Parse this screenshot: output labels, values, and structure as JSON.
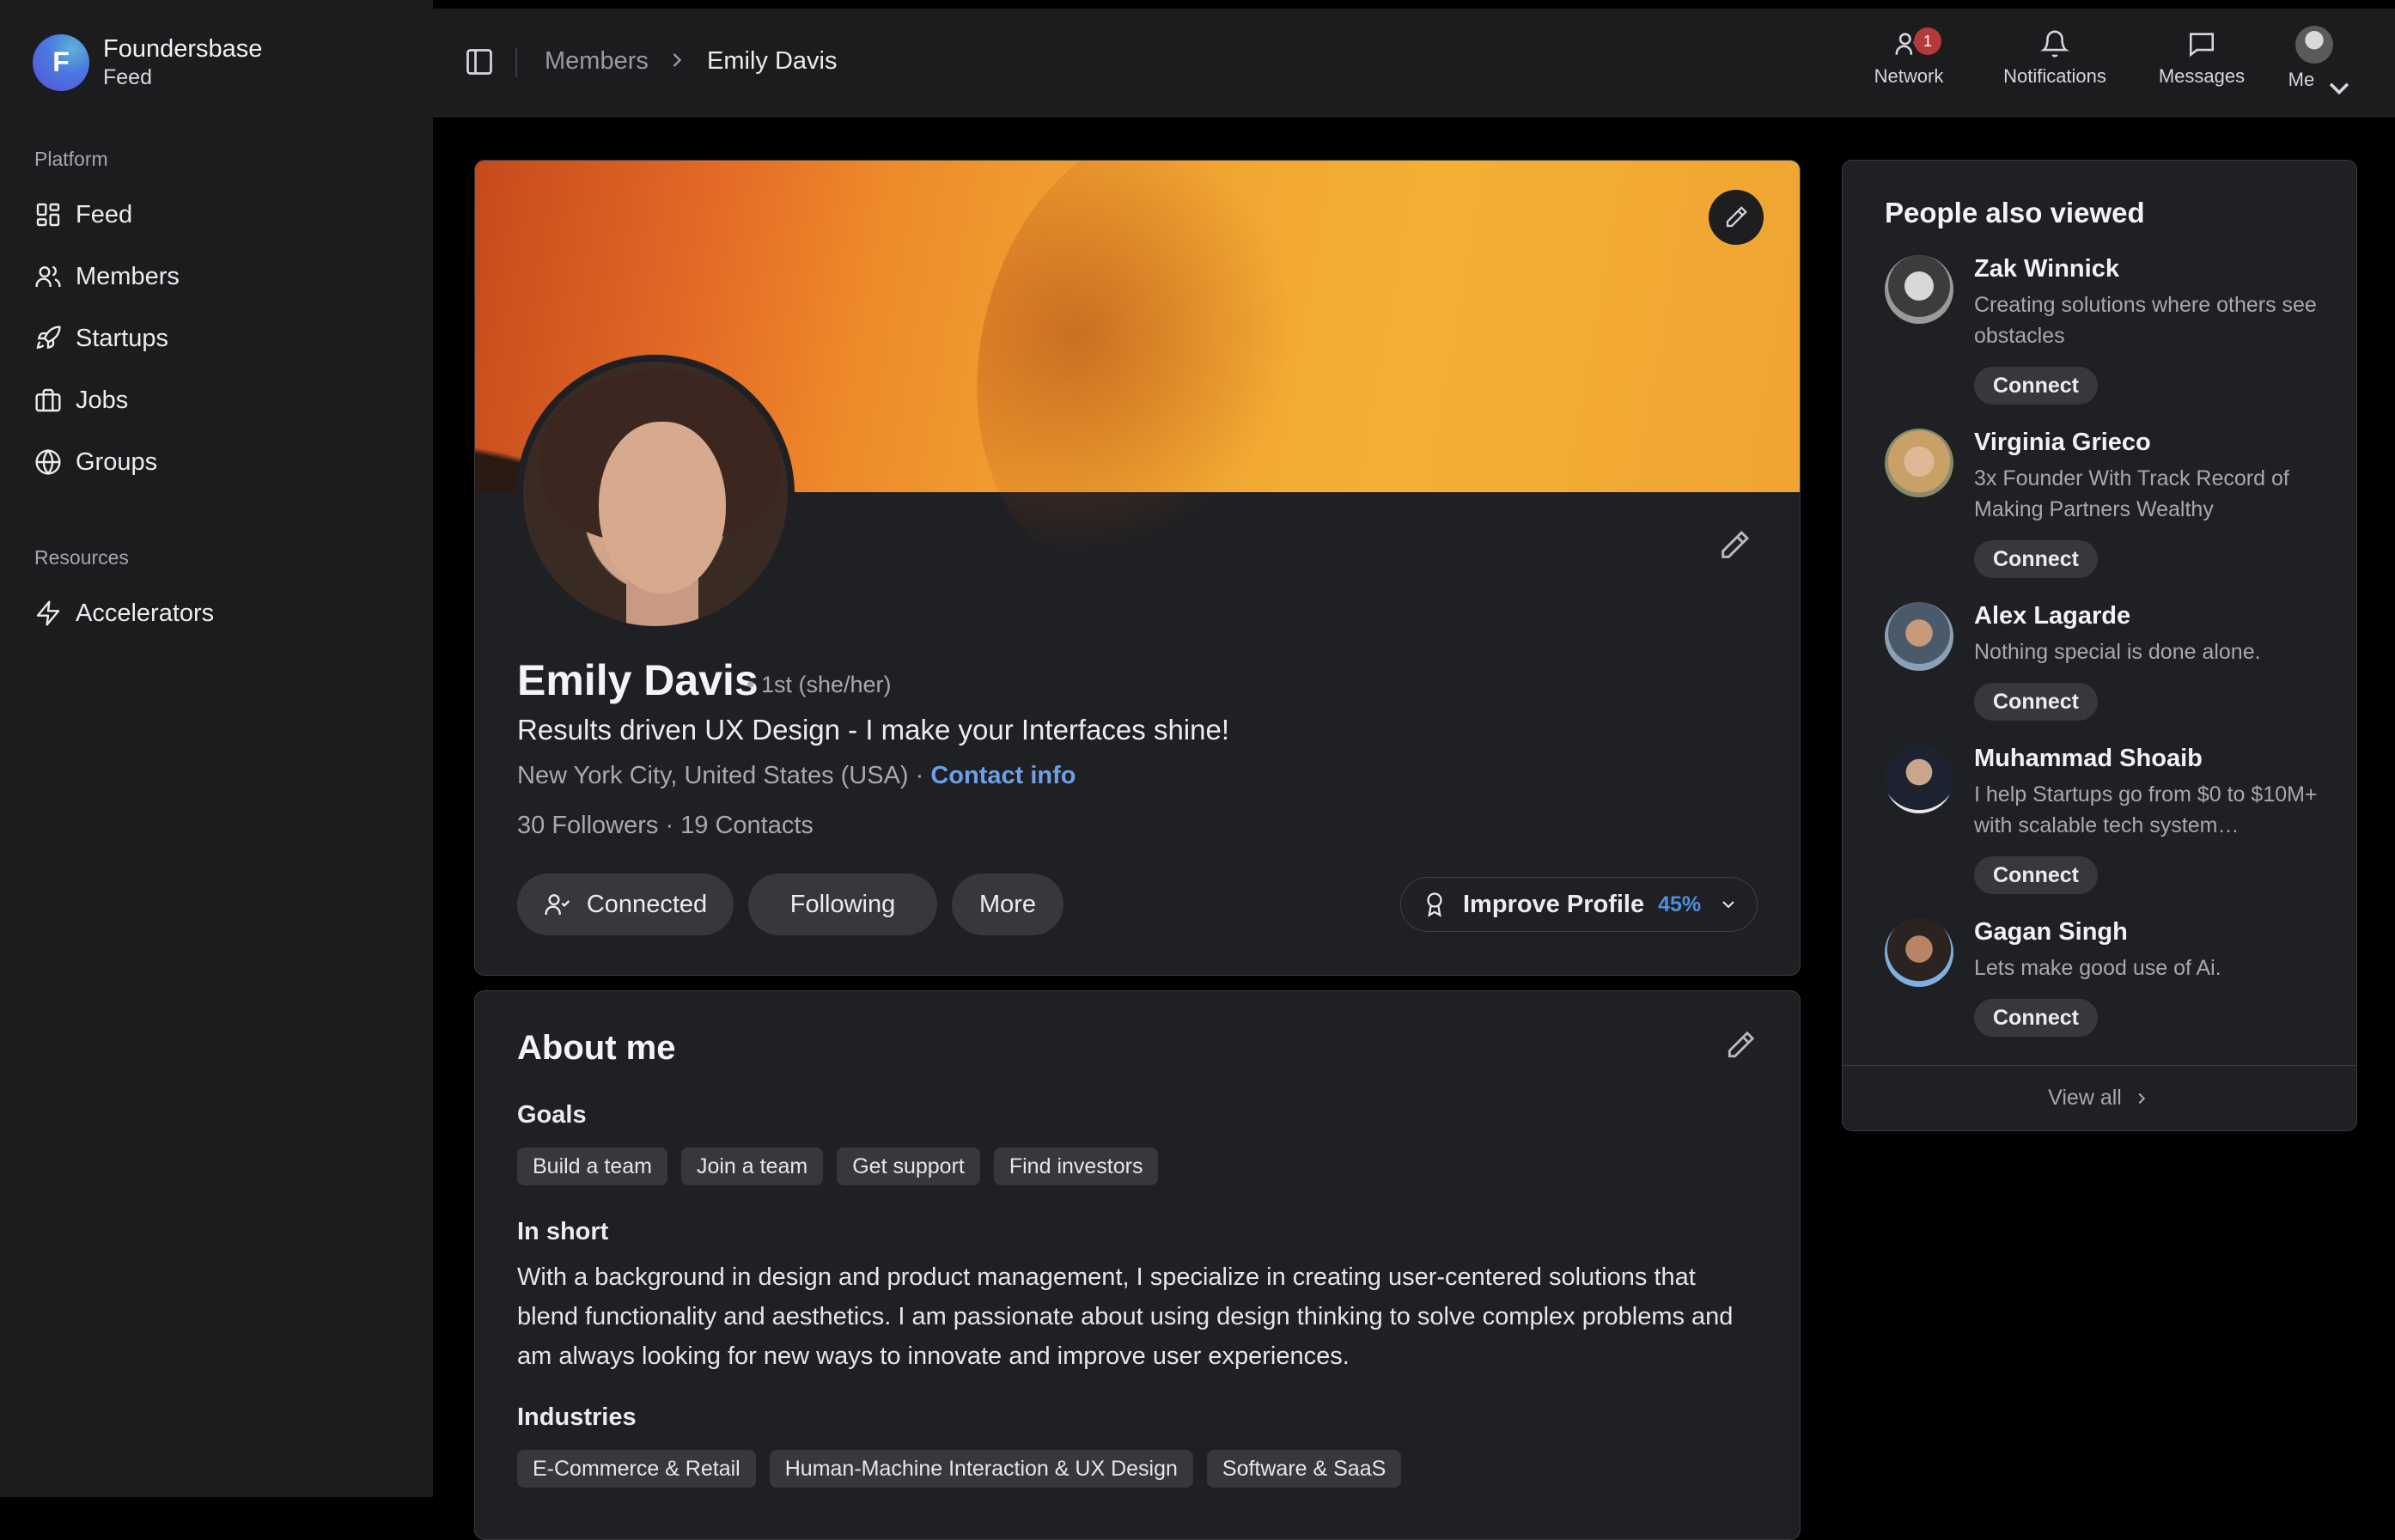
{
  "brand": {
    "initial": "F",
    "name": "Foundersbase",
    "subtitle": "Feed"
  },
  "sidebar": {
    "platform_label": "Platform",
    "platform_items": [
      {
        "label": "Feed",
        "icon": "grid-icon"
      },
      {
        "label": "Members",
        "icon": "users-icon"
      },
      {
        "label": "Startups",
        "icon": "rocket-icon"
      },
      {
        "label": "Jobs",
        "icon": "briefcase-icon"
      },
      {
        "label": "Groups",
        "icon": "globe-icon"
      }
    ],
    "resources_label": "Resources",
    "resources_items": [
      {
        "label": "Accelerators",
        "icon": "lightning-icon"
      }
    ]
  },
  "topbar": {
    "breadcrumb": [
      "Members",
      "Emily Davis"
    ],
    "actions": {
      "network": {
        "label": "Network",
        "badge": "1"
      },
      "notifications": {
        "label": "Notifications"
      },
      "messages": {
        "label": "Messages"
      },
      "me": {
        "label": "Me"
      }
    }
  },
  "profile": {
    "name": "Emily Davis",
    "degree": "• 1st  (she/her)",
    "headline": "Results driven UX Design - I make your Interfaces shine!",
    "location": "New York City, United States (USA) · ",
    "contact_info": "Contact info",
    "stats": "30 Followers  ·  19 Contacts",
    "buttons": {
      "connected": "Connected",
      "following": "Following",
      "more": "More"
    },
    "improve": {
      "label": "Improve Profile",
      "percent": "45%"
    }
  },
  "about": {
    "title": "About me",
    "goals_label": "Goals",
    "goals": [
      "Build a team",
      "Join a team",
      "Get support",
      "Find investors"
    ],
    "in_short_label": "In short",
    "in_short": "With a background in design and product management, I specialize in creating user-centered solutions that blend functionality and aesthetics. I am passionate about using design thinking to solve complex problems and am always looking for new ways to innovate and improve user experiences.",
    "industries_label": "Industries",
    "industries": [
      "E-Commerce & Retail",
      "Human-Machine Interaction & UX Design",
      "Software & SaaS"
    ]
  },
  "people_also_viewed": {
    "title": "People also viewed",
    "connect_label": "Connect",
    "people": [
      {
        "name": "Zak Winnick",
        "desc": "Creating solutions where others see obstacles"
      },
      {
        "name": "Virginia Grieco",
        "desc": "3x Founder With Track Record of Making Partners Wealthy"
      },
      {
        "name": "Alex Lagarde",
        "desc": "Nothing special is done alone."
      },
      {
        "name": "Muhammad Shoaib",
        "desc": "I help Startups go from $0 to $10M+ with scalable tech system…"
      },
      {
        "name": "Gagan Singh",
        "desc": "Lets make good use of Ai."
      }
    ],
    "view_all": "View all"
  },
  "colors": {
    "accent_link": "#6f9fe6",
    "progress_percent": "#4d8fe0",
    "badge": "#b33a3a"
  }
}
